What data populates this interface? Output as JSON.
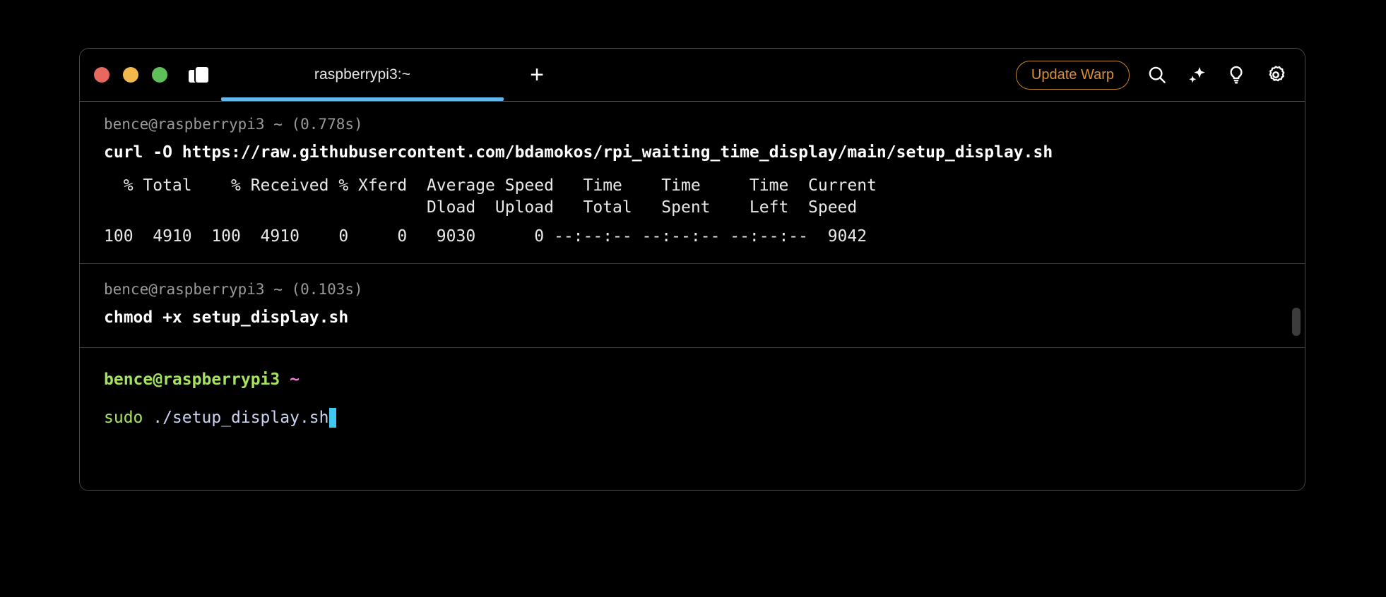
{
  "window": {
    "traffic_lights": [
      {
        "name": "close",
        "color": "#E8675F"
      },
      {
        "name": "minimize",
        "color": "#F2B84B"
      },
      {
        "name": "maximize",
        "color": "#5FC05A"
      }
    ],
    "panes_icon": "split-panes-icon",
    "accent_tab_underline": "#62B8EC"
  },
  "tabs": [
    {
      "label": "raspberrypi3:~",
      "active": true
    }
  ],
  "newtab_label": "+",
  "toolbar": {
    "update_label": "Update Warp",
    "update_color": "#D9903A",
    "icons": [
      {
        "name": "search-icon"
      },
      {
        "name": "sparkle-ai-icon"
      },
      {
        "name": "lightbulb-icon"
      },
      {
        "name": "gear-icon"
      }
    ]
  },
  "blocks": [
    {
      "prompt": "bence@raspberrypi3 ~ (0.778s)",
      "command": "curl -O https://raw.githubusercontent.com/bdamokos/rpi_waiting_time_display/main/setup_display.sh",
      "output": [
        "  % Total    % Received % Xferd  Average Speed   Time    Time     Time  Current",
        "                                 Dload  Upload   Total   Spent    Left  Speed",
        "100  4910  100  4910    0     0   9030      0 --:--:-- --:--:-- --:--:--  9042"
      ]
    },
    {
      "prompt": "bence@raspberrypi3 ~ (0.103s)",
      "command": "chmod +x setup_display.sh",
      "output": []
    }
  ],
  "active_block": {
    "prompt_user": "bence@raspberrypi3",
    "prompt_path": "~",
    "input_command": "sudo",
    "input_args": " ./setup_display.sh",
    "cursor_color": "#3FC8F0"
  }
}
